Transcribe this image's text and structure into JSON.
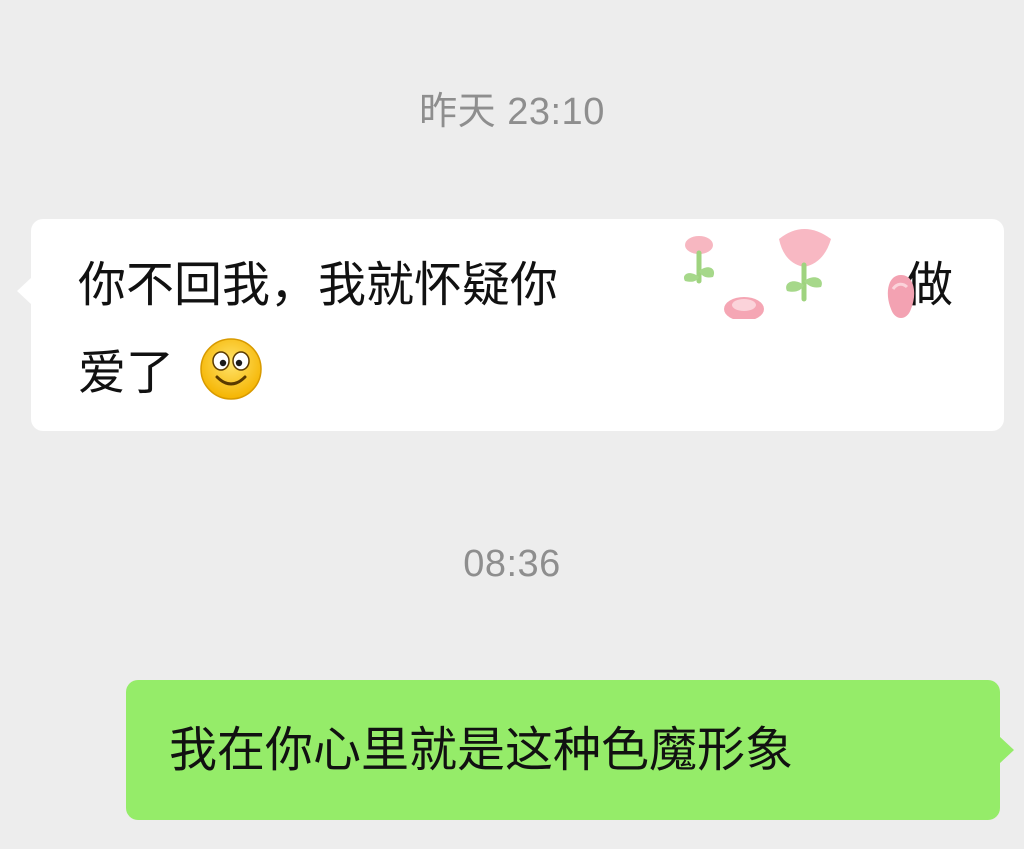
{
  "chat": {
    "timestamp_1": "昨天 23:10",
    "incoming_message": {
      "line_1": "你不回我，我就怀疑你",
      "line_1_end": "做",
      "line_2": "爱了",
      "emoji": "smile-emoji"
    },
    "timestamp_2": "08:36",
    "outgoing_message": {
      "text": "我在你心里就是这种色魔形象"
    }
  },
  "colors": {
    "background": "#ededed",
    "incoming_bubble": "#ffffff",
    "outgoing_bubble": "#95ec69",
    "timestamp_text": "#8e8e8e",
    "message_text": "#111111"
  },
  "icons": [
    "smile-emoji",
    "flower-sticker"
  ]
}
